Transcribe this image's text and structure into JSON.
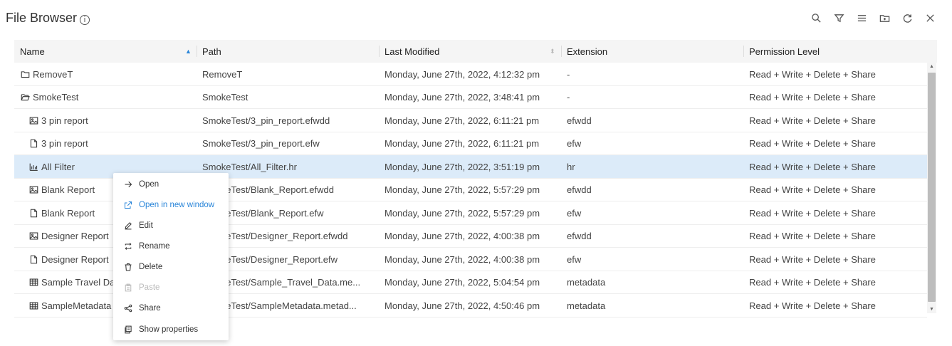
{
  "title": "File Browser",
  "info_glyph": "i",
  "toolbar_icons": [
    "search-icon",
    "filter-icon",
    "menu-icon",
    "new-folder-icon",
    "refresh-icon",
    "close-icon"
  ],
  "columns": {
    "name": "Name",
    "path": "Path",
    "last_modified": "Last Modified",
    "extension": "Extension",
    "permission": "Permission Level"
  },
  "rows": [
    {
      "icon": "folder-icon",
      "name": "RemoveT",
      "path": "RemoveT",
      "modified": "Monday, June 27th, 2022, 4:12:32 pm",
      "ext": "-",
      "perm": "Read + Write + Delete + Share",
      "indent": 0
    },
    {
      "icon": "folder-open-icon",
      "name": "SmokeTest",
      "path": "SmokeTest",
      "modified": "Monday, June 27th, 2022, 3:48:41 pm",
      "ext": "-",
      "perm": "Read + Write + Delete + Share",
      "indent": 0
    },
    {
      "icon": "image-icon",
      "name": "3 pin report",
      "path": "SmokeTest/3_pin_report.efwdd",
      "modified": "Monday, June 27th, 2022, 6:11:21 pm",
      "ext": "efwdd",
      "perm": "Read + Write + Delete + Share",
      "indent": 1
    },
    {
      "icon": "file-icon",
      "name": "3 pin report",
      "path": "SmokeTest/3_pin_report.efw",
      "modified": "Monday, June 27th, 2022, 6:11:21 pm",
      "ext": "efw",
      "perm": "Read + Write + Delete + Share",
      "indent": 1
    },
    {
      "icon": "bar-chart-icon",
      "name": "All Filter",
      "path": "SmokeTest/All_Filter.hr",
      "modified": "Monday, June 27th, 2022, 3:51:19 pm",
      "ext": "hr",
      "perm": "Read + Write + Delete + Share",
      "indent": 1,
      "selected": true
    },
    {
      "icon": "image-icon",
      "name": "Blank Report",
      "path": "SmokeTest/Blank_Report.efwdd",
      "modified": "Monday, June 27th, 2022, 5:57:29 pm",
      "ext": "efwdd",
      "perm": "Read + Write + Delete + Share",
      "indent": 1
    },
    {
      "icon": "file-icon",
      "name": "Blank Report",
      "path": "SmokeTest/Blank_Report.efw",
      "modified": "Monday, June 27th, 2022, 5:57:29 pm",
      "ext": "efw",
      "perm": "Read + Write + Delete + Share",
      "indent": 1
    },
    {
      "icon": "image-icon",
      "name": "Designer Report",
      "path": "SmokeTest/Designer_Report.efwdd",
      "modified": "Monday, June 27th, 2022, 4:00:38 pm",
      "ext": "efwdd",
      "perm": "Read + Write + Delete + Share",
      "indent": 1
    },
    {
      "icon": "file-icon",
      "name": "Designer Report",
      "path": "SmokeTest/Designer_Report.efw",
      "modified": "Monday, June 27th, 2022, 4:00:38 pm",
      "ext": "efw",
      "perm": "Read + Write + Delete + Share",
      "indent": 1
    },
    {
      "icon": "table-icon",
      "name": "Sample Travel Data",
      "path": "SmokeTest/Sample_Travel_Data.me...",
      "modified": "Monday, June 27th, 2022, 5:04:54 pm",
      "ext": "metadata",
      "perm": "Read + Write + Delete + Share",
      "indent": 1
    },
    {
      "icon": "table-icon",
      "name": "SampleMetadata",
      "path": "SmokeTest/SampleMetadata.metad...",
      "modified": "Monday, June 27th, 2022, 4:50:46 pm",
      "ext": "metadata",
      "perm": "Read + Write + Delete + Share",
      "indent": 1
    }
  ],
  "context_menu": [
    {
      "icon": "arrow-right-icon",
      "label": "Open"
    },
    {
      "icon": "external-window-icon",
      "label": "Open in new window",
      "active": true
    },
    {
      "icon": "edit-icon",
      "label": "Edit"
    },
    {
      "icon": "rename-icon",
      "label": "Rename"
    },
    {
      "icon": "trash-icon",
      "label": "Delete"
    },
    {
      "icon": "paste-icon",
      "label": "Paste",
      "disabled": true
    },
    {
      "icon": "share-icon",
      "label": "Share"
    },
    {
      "icon": "properties-icon",
      "label": "Show properties"
    }
  ],
  "colors": {
    "accent": "#2b86d9",
    "selected_row": "#dcebf9",
    "header_bg": "#f5f5f5"
  }
}
